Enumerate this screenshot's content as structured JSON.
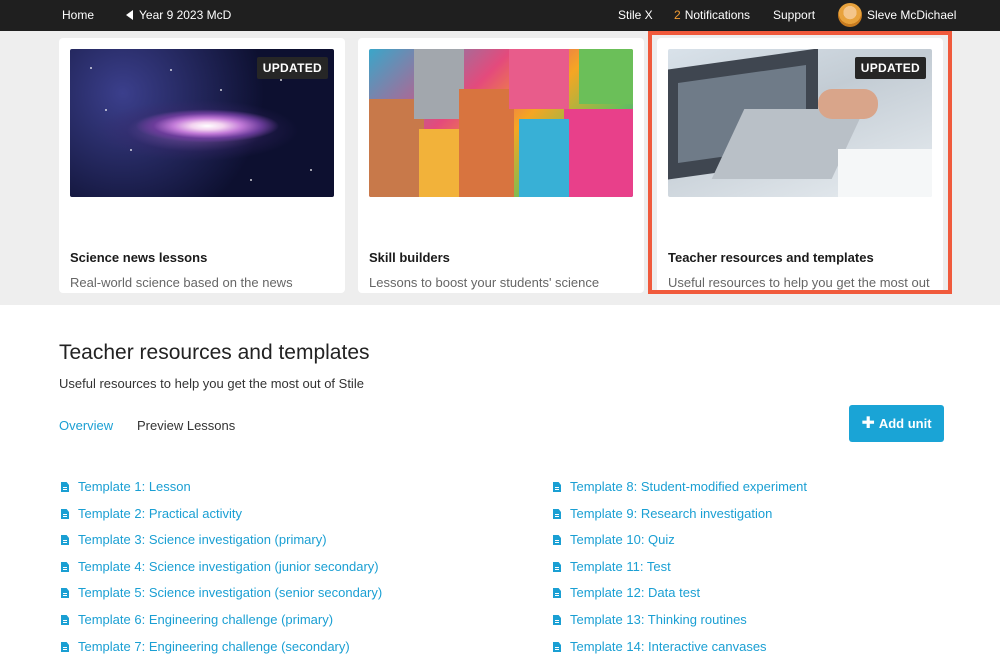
{
  "nav": {
    "home": "Home",
    "class": "Year 9 2023 McD",
    "stile_x": "Stile X",
    "notifications_count": "2",
    "notifications_label": "Notifications",
    "support": "Support",
    "user_name": "Sleve McDichael"
  },
  "cards": [
    {
      "title": "Science news lessons",
      "desc": "Real-world science based on the news",
      "badge": "UPDATED",
      "image_icon": "galaxy-image"
    },
    {
      "title": "Skill builders",
      "desc": "Lessons to boost your students' science inquiry skills",
      "badge": "",
      "image_icon": "blocks-image"
    },
    {
      "title": "Teacher resources and templates",
      "desc": "Useful resources to help you get the most out of Stile",
      "badge": "UPDATED",
      "image_icon": "laptop-image"
    }
  ],
  "highlight_color": "#f05a3c",
  "section": {
    "title": "Teacher resources and templates",
    "subtitle": "Useful resources to help you get the most out of Stile",
    "tabs": [
      "Overview",
      "Preview Lessons"
    ],
    "add_button": "Add unit"
  },
  "templates_left": [
    "Template 1: Lesson",
    "Template 2: Practical activity",
    "Template 3: Science investigation (primary)",
    "Template 4: Science investigation (junior secondary)",
    "Template 5: Science investigation (senior secondary)",
    "Template 6: Engineering challenge (primary)",
    "Template 7: Engineering challenge (secondary)"
  ],
  "templates_right": [
    "Template 8: Student-modified experiment",
    "Template 9: Research investigation",
    "Template 10: Quiz",
    "Template 11: Test",
    "Template 12: Data test",
    "Template 13: Thinking routines",
    "Template 14: Interactive canvases"
  ],
  "colors": {
    "accent": "#1aa4d6",
    "link": "#1a9fd3",
    "topbar": "#1f1f1f"
  }
}
